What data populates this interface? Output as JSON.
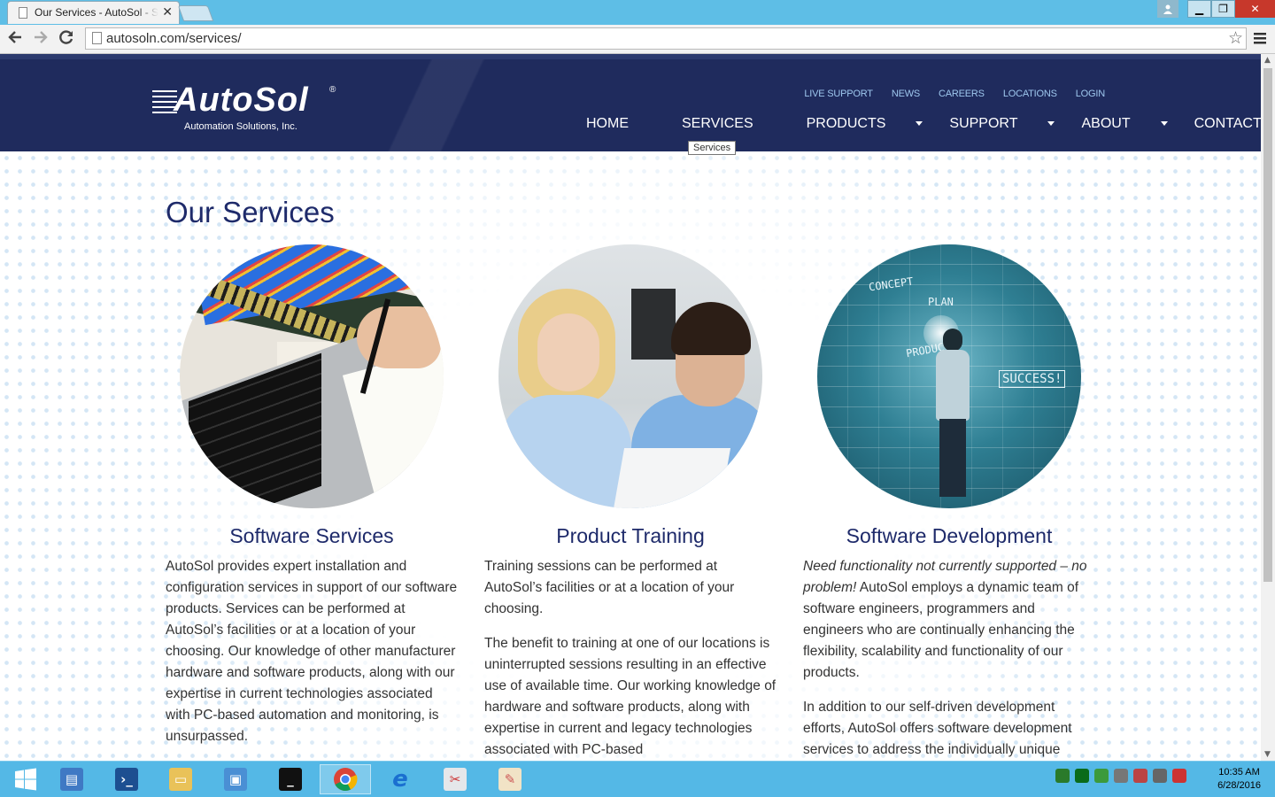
{
  "browser": {
    "tab_title": "Our Services - AutoSol - S",
    "tab_close": "✕",
    "url": "autosoln.com/services/",
    "window_buttons": {
      "minimize": "▁",
      "maximize": "❐",
      "close": "✕"
    },
    "icons": [
      "back-icon",
      "forward-icon",
      "reload-icon",
      "page-icon",
      "bookmark-star-icon",
      "menu-icon"
    ]
  },
  "site": {
    "logo": {
      "name": "AutoSol",
      "registered": "®",
      "tagline": "Automation Solutions, Inc."
    },
    "utility_nav": [
      "LIVE SUPPORT",
      "NEWS",
      "CAREERS",
      "LOCATIONS",
      "LOGIN"
    ],
    "main_nav": [
      {
        "label": "HOME",
        "active": false,
        "dropdown": false
      },
      {
        "label": "SERVICES",
        "active": true,
        "dropdown": false
      },
      {
        "label": "PRODUCTS",
        "active": false,
        "dropdown": true
      },
      {
        "label": "SUPPORT",
        "active": false,
        "dropdown": true
      },
      {
        "label": "ABOUT",
        "active": false,
        "dropdown": true
      },
      {
        "label": "CONTACT",
        "active": false,
        "dropdown": false
      }
    ],
    "tooltip": "Services",
    "colors": {
      "header_bg": "#1f2b5d",
      "active_nav": "#4ab6e7",
      "heading": "#1e2a6a"
    }
  },
  "page": {
    "title": "Our Services",
    "columns": [
      {
        "heading": "Software Services",
        "paragraphs": [
          "AutoSol provides expert installation and configuration services in support of our software products.  Services can be performed at AutoSol’s facilities or at a location of your choosing.  Our knowledge of other manufacturer hardware and software products, along with our expertise in current technologies associated with PC-based automation and monitoring, is unsurpassed."
        ]
      },
      {
        "heading": "Product Training",
        "paragraphs": [
          "Training sessions can be performed at AutoSol’s facilities or at a location of your choosing.",
          "The benefit to training at one of our locations is uninterrupted sessions resulting in an effective use of available time. Our working knowledge of hardware and software products, along with expertise in current and legacy technologies associated with PC-based"
        ]
      },
      {
        "heading": "Software Development",
        "italic_lead": "Need functionality not currently supported – no problem!",
        "paragraphs": [
          " AutoSol employs a dynamic team of software engineers, programmers and engineers who are continually enhancing the flexibility, scalability and functionality of our products.",
          "In addition to our self-driven development efforts, AutoSol offers software development services to address the individually unique"
        ]
      }
    ],
    "photo3_labels": [
      "CONCEPT",
      "PLAN",
      "PRODUCT",
      "SUCCESS!"
    ]
  },
  "taskbar": {
    "items": [
      "start-icon",
      "server-manager-icon",
      "powershell-icon",
      "file-explorer-icon",
      "remote-desktop-icon",
      "command-prompt-icon",
      "chrome-icon",
      "internet-explorer-icon",
      "snipping-tool-icon",
      "paint-icon"
    ],
    "clock_time": "10:35 AM",
    "clock_date": "6/28/2016"
  }
}
